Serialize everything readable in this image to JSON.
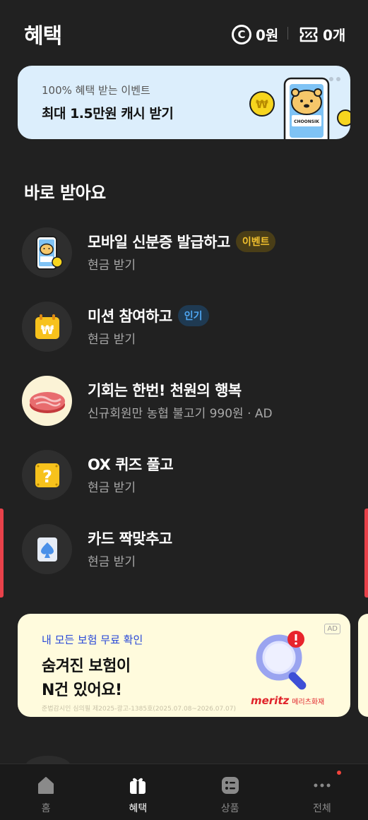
{
  "header": {
    "title": "혜택",
    "points_icon": "coin-icon",
    "points_value": "0원",
    "coupons_icon": "coupon-icon",
    "coupons_value": "0개"
  },
  "event_banner": {
    "subtitle": "100% 혜택 받는 이벤트",
    "title": "최대 1.5만원 캐시 받기",
    "art_label": "CHOONSIK"
  },
  "section": {
    "title": "바로 받아요"
  },
  "items": [
    {
      "title": "모바일 신분증 발급하고",
      "badge": "이벤트",
      "subtitle": "현금 받기",
      "icon": "mobile-id-icon"
    },
    {
      "title": "미션 참여하고",
      "badge": "인기",
      "subtitle": "현금 받기",
      "icon": "calendar-won-icon"
    },
    {
      "title": "기회는 한번! 천원의 행복",
      "subtitle": "신규회원만 농협 불고기 990원 · AD",
      "icon": "meat-icon"
    },
    {
      "title": "OX 퀴즈 풀고",
      "subtitle": "현금 받기",
      "icon": "question-box-icon"
    },
    {
      "title": "카드 짝맞추고",
      "subtitle": "현금 받기",
      "icon": "spade-card-icon"
    }
  ],
  "ad_banner": {
    "subtitle": "내 모든 보험 무료 확인",
    "title_line1": "숨겨진 보험이",
    "title_line2": "N건 있어요!",
    "fine_print": "준법감시인 심의필 제2025-광고-1385호(2025.07.08~2026.07.07)",
    "ad_label": "AD",
    "brand_en": "meritz",
    "brand_ko": "메리츠화재",
    "icon": "magnifier-alert-icon"
  },
  "nav": {
    "items": [
      {
        "label": "홈",
        "icon": "home-icon"
      },
      {
        "label": "혜택",
        "icon": "gift-icon"
      },
      {
        "label": "상품",
        "icon": "product-icon"
      },
      {
        "label": "전체",
        "icon": "more-icon"
      }
    ],
    "active": "혜택"
  },
  "colors": {
    "background": "#212121",
    "event_badge": "#f2c12e",
    "popular_badge": "#4ea6f2",
    "ad_subtitle": "#2747d8",
    "brand": "#e0242b",
    "notification_dot": "#f2433b"
  }
}
